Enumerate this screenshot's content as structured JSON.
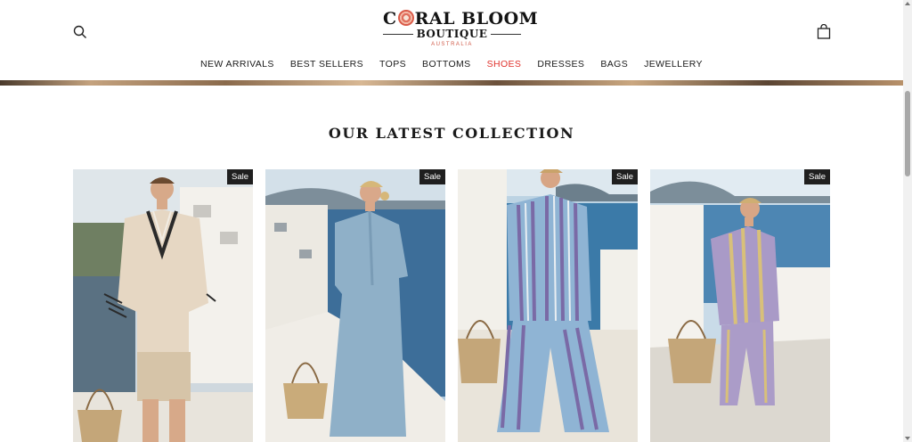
{
  "brand": {
    "name_top_left": "C",
    "name_top_right": "RAL BLOOM",
    "name_sub": "BOUTIQUE",
    "country": "AUSTRALIA"
  },
  "header": {
    "search_icon": "search-icon",
    "cart_icon": "shopping-bag-icon"
  },
  "nav": {
    "items": [
      {
        "label": "NEW ARRIVALS"
      },
      {
        "label": "BEST SELLERS"
      },
      {
        "label": "TOPS"
      },
      {
        "label": "BOTTOMS"
      },
      {
        "label": "SHOES",
        "active": true
      },
      {
        "label": "DRESSES"
      },
      {
        "label": "BAGS"
      },
      {
        "label": "JEWELLERY"
      }
    ],
    "active_color": "#e0322c"
  },
  "section": {
    "title": "OUR LATEST COLLECTION"
  },
  "products": [
    {
      "badge": "Sale"
    },
    {
      "badge": "Sale"
    },
    {
      "badge": "Sale"
    },
    {
      "badge": "Sale"
    }
  ],
  "colors": {
    "badge_bg": "#1f1f1f",
    "accent": "#d05a48"
  }
}
